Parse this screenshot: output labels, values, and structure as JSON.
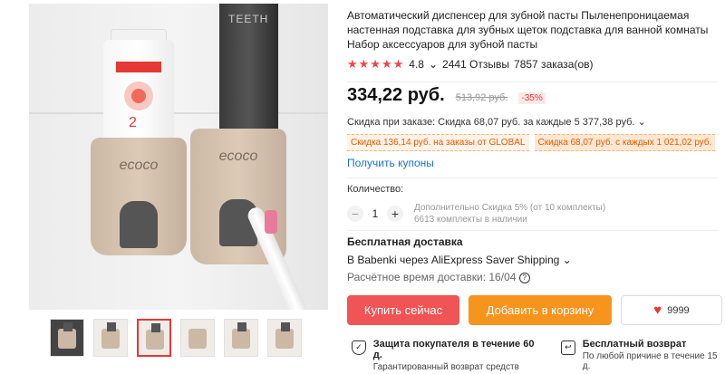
{
  "product": {
    "title": "Автоматический диспенсер для зубной пасты Пыленепроницаемая настенная подставка для зубных щеток подставка для ванной комнаты Набор аксессуаров для зубной пасты",
    "rating": "4.8",
    "reviews": "2441 Отзывы",
    "orders": "7857 заказа(ов)",
    "price": "334,22 руб.",
    "old_price": "513,92 руб.",
    "discount_pct": "-35%",
    "store_discount": "Скидка при заказе: Скидка 68,07 руб. за каждые 5 377,38 руб.",
    "coupons": [
      "Скидка 136,14 руб. на заказы от GLOBAL",
      "Скидка 68,07 руб. с каждых 1 021,02 руб."
    ],
    "get_coupons": "Получить купоны"
  },
  "image": {
    "tube_dark_text": "TEETH",
    "dispenser_logo": "ecoco",
    "thumbnail_count": 6,
    "active_thumbnail": 3
  },
  "quantity": {
    "label": "Количество:",
    "minus": "−",
    "value": "1",
    "plus": "+",
    "note_line1": "Дополнительно Скидка 5% (от 10 комплекты)",
    "note_line2": "6613 комплекты в наличии"
  },
  "shipping": {
    "title": "Бесплатная доставка",
    "route": "В Babenki через AliExpress Saver Shipping",
    "time": "Расчётное время доставки: 16/04"
  },
  "actions": {
    "buy": "Купить сейчас",
    "cart": "Добавить в корзину",
    "wishlist_count": "9999"
  },
  "guarantees": [
    {
      "title": "Защита покупателя в течение 60 д.",
      "sub": "Гарантированный возврат средств"
    },
    {
      "title": "Бесплатный возврат",
      "sub": "По любой причине в течение 15 д."
    }
  ],
  "colors": {
    "accent": "#f05454",
    "cart": "#f7941d",
    "link": "#1a73c9"
  }
}
